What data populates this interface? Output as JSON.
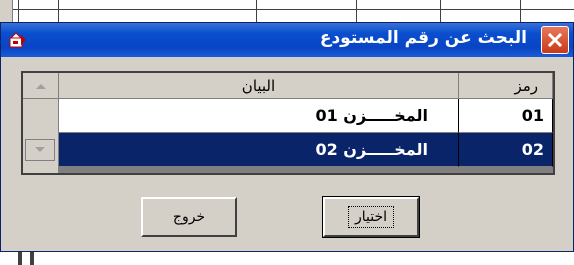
{
  "dialog": {
    "title": "البحث عن رقم المستودع",
    "close_label": "×"
  },
  "grid": {
    "headers": {
      "description": "البيان",
      "code": "رمز"
    },
    "rows": [
      {
        "description": "المخـــــزن 01",
        "code": "01",
        "selected": false
      },
      {
        "description": "المخـــــزن 02",
        "code": "02",
        "selected": true
      }
    ]
  },
  "buttons": {
    "choose_label": "اختيار",
    "exit_label": "خروج"
  },
  "colors": {
    "titlebar": "#0845c4",
    "selection": "#0a246a",
    "face": "#d4d0c8"
  }
}
